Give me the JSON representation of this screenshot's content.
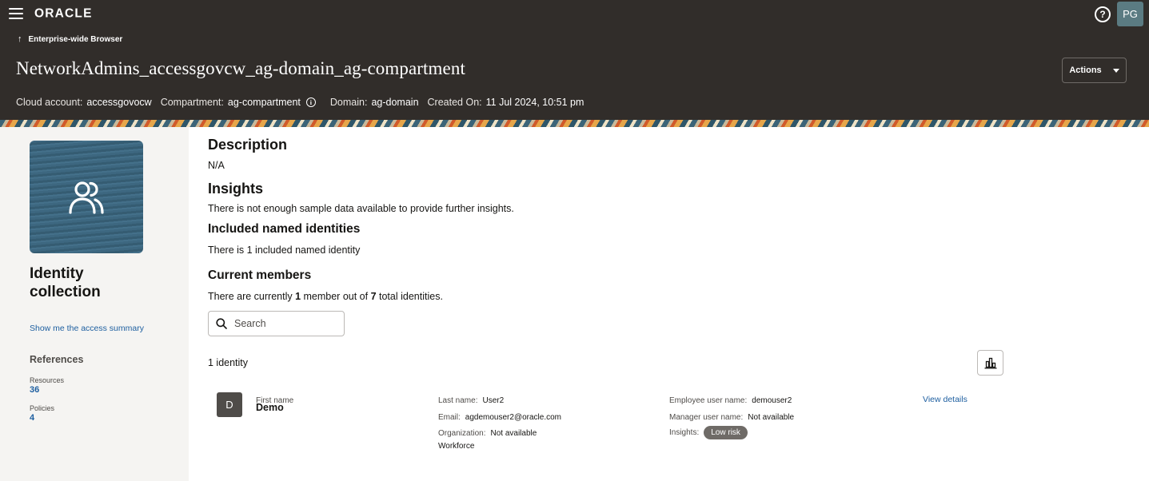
{
  "header": {
    "logo_text": "ORACLE",
    "avatar_initials": "PG",
    "help_icon": "help-circle-icon",
    "breadcrumb": "Enterprise-wide Browser",
    "title": "NetworkAdmins_accessgovcw_ag-domain_ag-compartment",
    "actions_label": "Actions",
    "meta": {
      "cloud_account_label": "Cloud account:",
      "cloud_account_value": "accessgovocw",
      "compartment_label": "Compartment:",
      "compartment_value": "ag-compartment",
      "domain_label": "Domain:",
      "domain_value": "ag-domain",
      "created_label": "Created On:",
      "created_value": "11 Jul 2024, 10:51 pm"
    }
  },
  "sidebar": {
    "collection_type": "Identity collection",
    "access_summary_link": "Show me the access summary",
    "references_title": "References",
    "resources_label": "Resources",
    "resources_value": "36",
    "policies_label": "Policies",
    "policies_value": "4"
  },
  "main": {
    "description_title": "Description",
    "description_text": "N/A",
    "insights_title": "Insights",
    "insights_text": "There is not enough sample data available to provide further insights.",
    "included_title": "Included named identities",
    "included_text": "There is 1 included named identity",
    "members_title": "Current members",
    "members_pre": "There are currently ",
    "members_count": "1",
    "members_mid": " member out of ",
    "members_total": "7",
    "members_post": " total identities.",
    "search_placeholder": "Search",
    "identity_count": "1 identity"
  },
  "identities": [
    {
      "initial": "D",
      "first_name_label": "First name",
      "first_name": "Demo",
      "last_name_label": "Last name:",
      "last_name": "User2",
      "email_label": "Email:",
      "email": "agdemouser2@oracle.com",
      "org_label": "Organization:",
      "org": "Not available",
      "type": "Workforce",
      "employee_username_label": "Employee user name:",
      "employee_username": "demouser2",
      "manager_username_label": "Manager user name:",
      "manager_username": "Not available",
      "insights_label": "Insights:",
      "risk": "Low risk",
      "view_details": "View details"
    }
  ]
}
